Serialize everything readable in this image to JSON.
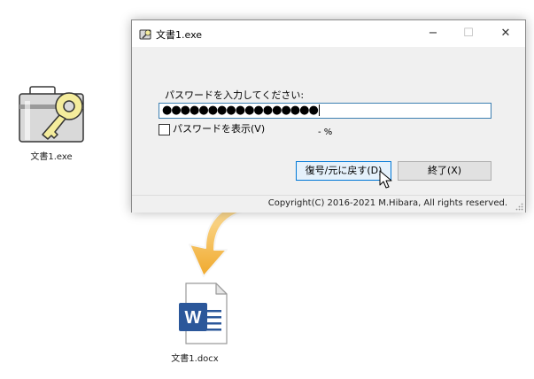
{
  "desktop": {
    "exe_icon_label": "文書1.exe",
    "docx_icon_label": "文書1.docx",
    "word_letter": "W"
  },
  "window": {
    "title": "文書1.exe",
    "controls": {
      "minimize": "−",
      "maximize": "☐",
      "close": "✕"
    },
    "prompt": "パスワードを入力してください:",
    "password_masked": "●●●●●●●●●●●●●●●●●",
    "show_password_label": "パスワードを表示(V)",
    "show_password_checked": false,
    "progress": "- %",
    "restore_button": "復号/元に戻す(D)",
    "exit_button": "終了(X)",
    "copyright": "Copyright(C) 2016-2021 M.Hibara, All rights reserved."
  },
  "colors": {
    "accent": "#0078d7",
    "arrow": "#f3b63f",
    "word_blue": "#2b579a",
    "key_yellow": "#f4ec9c"
  },
  "icons": [
    "briefcase-key-icon",
    "word-document-icon",
    "mouse-pointer-icon",
    "curved-arrow-icon"
  ]
}
